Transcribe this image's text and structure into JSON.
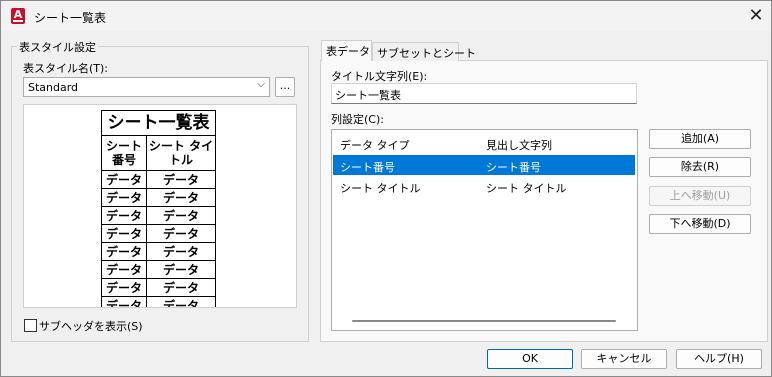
{
  "window": {
    "title": "シート一覧表",
    "app_icon_letter": "A"
  },
  "left_group": {
    "title": "表スタイル設定",
    "style_name_label": "表スタイル名(T):",
    "style_value": "Standard",
    "browse_button": "...",
    "preview": {
      "title": "シート一覧表",
      "headers": [
        "シート\n番号",
        "シート タイ\nトル"
      ],
      "cell_text": "データ",
      "visible_rows": 8
    },
    "subheader_checkbox_label": "サブヘッダを表示(S)",
    "subheader_checked": false
  },
  "tabs": [
    {
      "label": "表データ",
      "active": true
    },
    {
      "label": "サブセットとシート",
      "active": false
    }
  ],
  "table_data": {
    "title_label": "タイトル文字列(E):",
    "title_value": "シート一覧表",
    "columns_label": "列設定(C):",
    "list_headers": [
      "データ タイプ",
      "見出し文字列"
    ],
    "rows": [
      {
        "type": "シート番号",
        "heading": "シート番号",
        "selected": true
      },
      {
        "type": "シート タイトル",
        "heading": "シート タイトル",
        "selected": false
      }
    ],
    "buttons": {
      "add": "追加(A)",
      "remove": "除去(R)",
      "move_up": "上へ移動(U)",
      "move_down": "下へ移動(D)"
    }
  },
  "footer": {
    "ok": "OK",
    "cancel": "キャンセル",
    "help": "ヘルプ(H)"
  },
  "colors": {
    "selection": "#0078d7",
    "brand": "#c8102e"
  }
}
